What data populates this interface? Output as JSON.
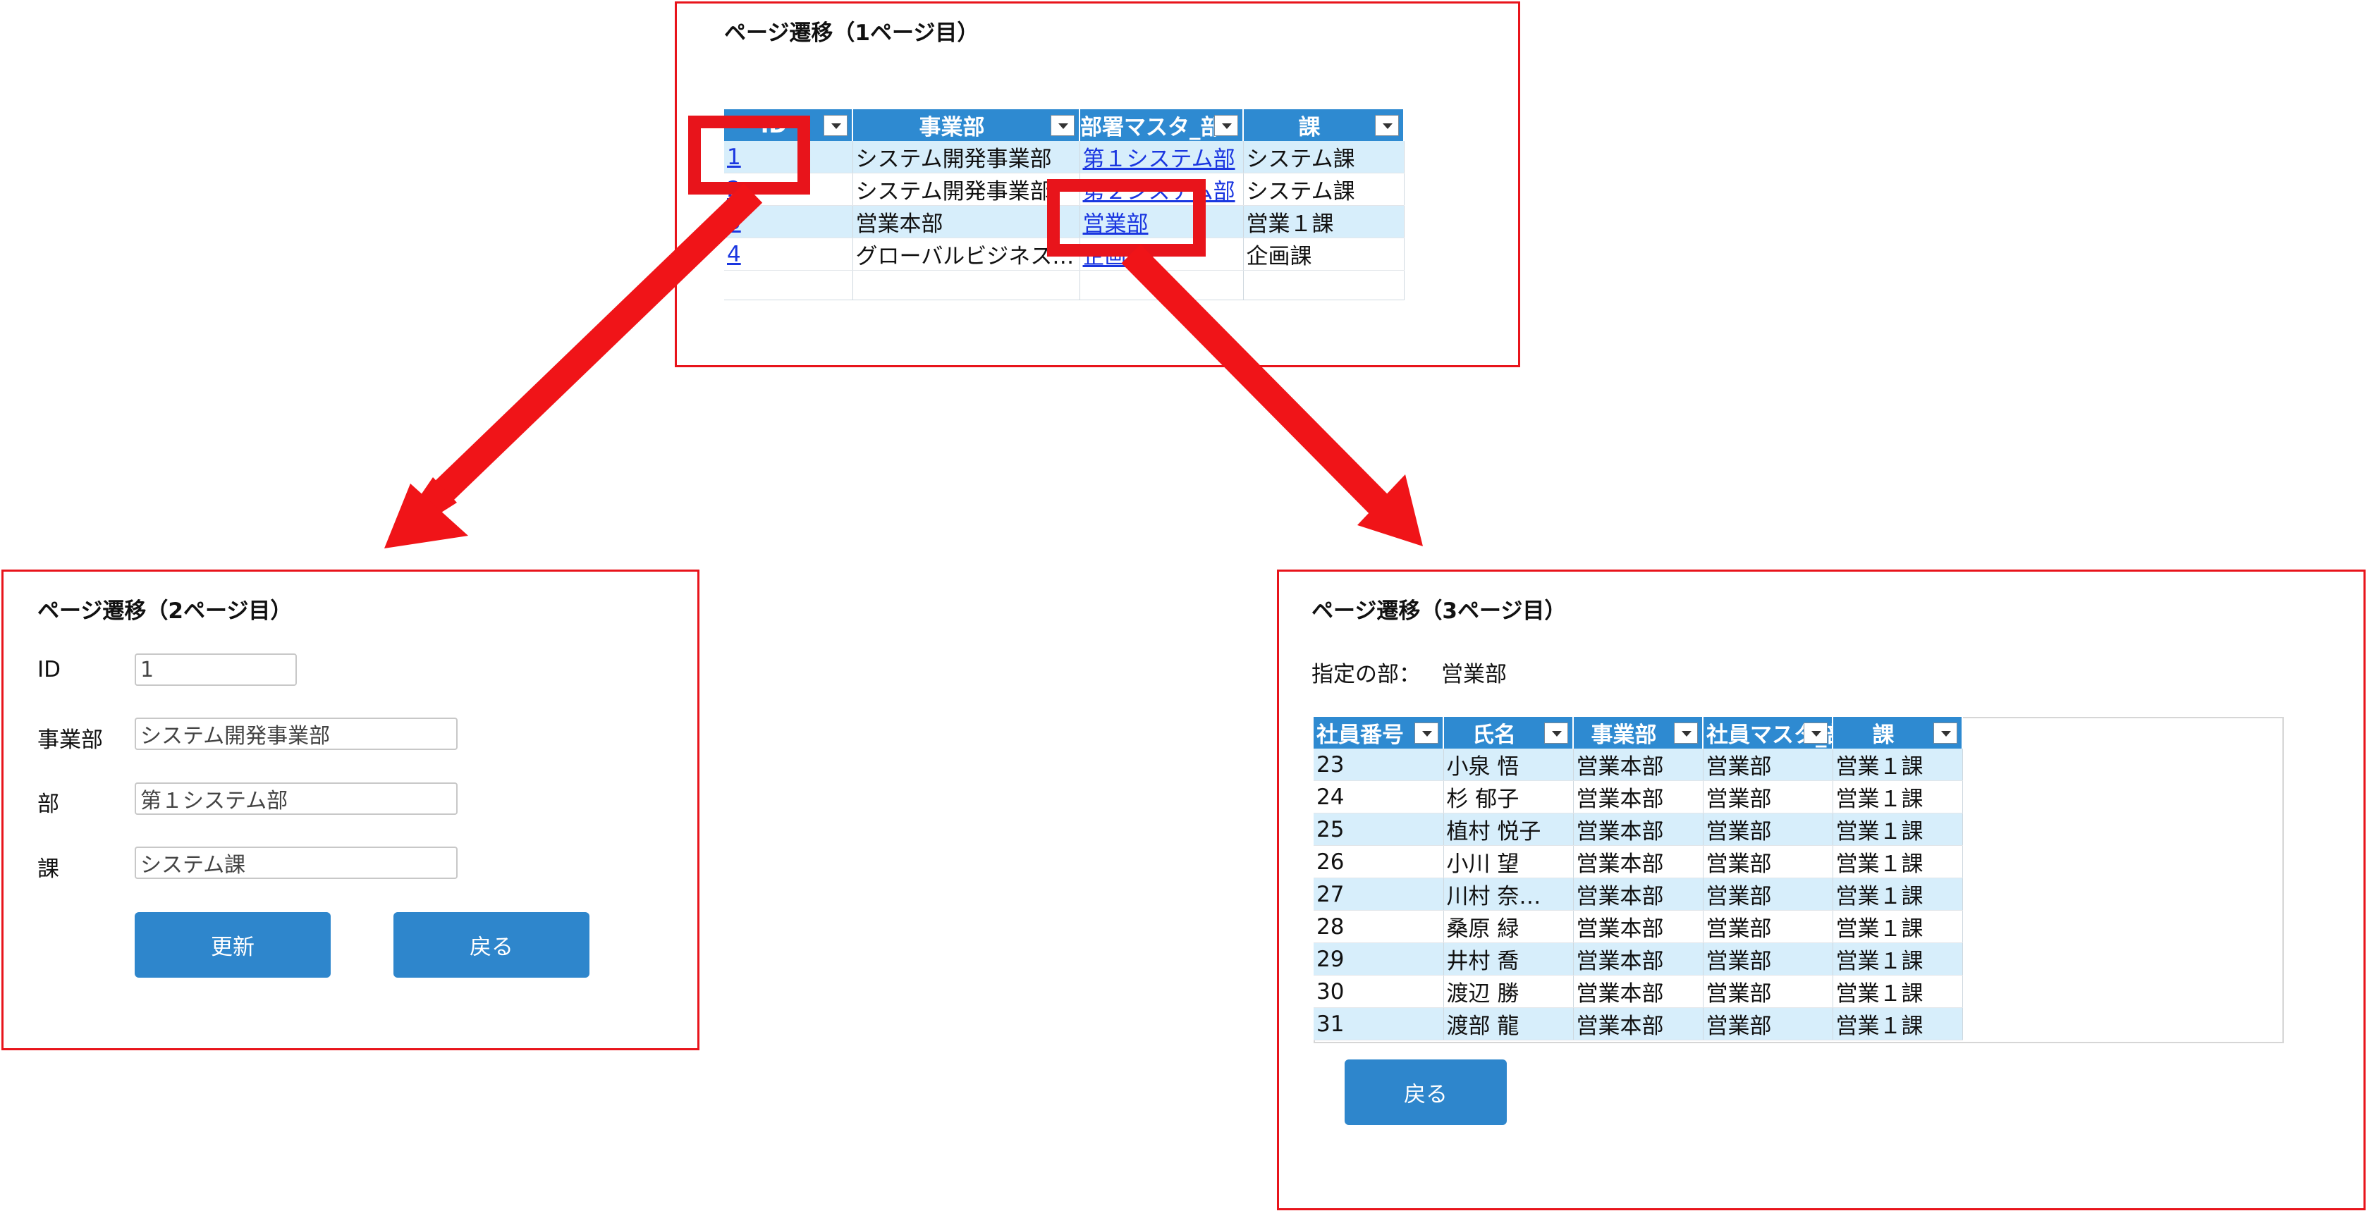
{
  "page1": {
    "title": "ページ遷移（1ページ目）",
    "columns": [
      "ID",
      "事業部",
      "部署マスタ_部",
      "課"
    ],
    "rows": [
      {
        "id": "1",
        "division": "システム開発事業部",
        "department": "第１システム部",
        "section": "システム課"
      },
      {
        "id": "2",
        "division": "システム開発事業部",
        "department": "第２システム部",
        "section": "システム課"
      },
      {
        "id": "3",
        "division": "営業本部",
        "department": "営業部",
        "section": "営業１課"
      },
      {
        "id": "4",
        "division": "グローバルビジネス事…",
        "department": "企画部",
        "section": "企画課"
      }
    ]
  },
  "page2": {
    "title": "ページ遷移（2ページ目）",
    "fields": {
      "id_label": "ID",
      "id_value": "1",
      "division_label": "事業部",
      "division_value": "システム開発事業部",
      "department_label": "部",
      "department_value": "第１システム部",
      "section_label": "課",
      "section_value": "システム課"
    },
    "update_button": "更新",
    "back_button": "戻る"
  },
  "page3": {
    "title": "ページ遷移（3ページ目）",
    "selected_label": "指定の部：",
    "selected_value": "営業部",
    "columns": [
      "社員番号",
      "氏名",
      "事業部",
      "社員マスタ_部",
      "課"
    ],
    "rows": [
      {
        "no": "23",
        "name": "小泉 悟",
        "division": "営業本部",
        "department": "営業部",
        "section": "営業１課"
      },
      {
        "no": "24",
        "name": "杉 郁子",
        "division": "営業本部",
        "department": "営業部",
        "section": "営業１課"
      },
      {
        "no": "25",
        "name": "植村 悦子",
        "division": "営業本部",
        "department": "営業部",
        "section": "営業１課"
      },
      {
        "no": "26",
        "name": "小川 望",
        "division": "営業本部",
        "department": "営業部",
        "section": "営業１課"
      },
      {
        "no": "27",
        "name": "川村 奈…",
        "division": "営業本部",
        "department": "営業部",
        "section": "営業１課"
      },
      {
        "no": "28",
        "name": "桑原 緑",
        "division": "営業本部",
        "department": "営業部",
        "section": "営業１課"
      },
      {
        "no": "29",
        "name": "井村 喬",
        "division": "営業本部",
        "department": "営業部",
        "section": "営業１課"
      },
      {
        "no": "30",
        "name": "渡辺 勝",
        "division": "営業本部",
        "department": "営業部",
        "section": "営業１課"
      },
      {
        "no": "31",
        "name": "渡部 龍",
        "division": "営業本部",
        "department": "営業部",
        "section": "営業１課"
      }
    ],
    "back_button": "戻る"
  },
  "colors": {
    "accent": "#2e86cc",
    "highlight": "#e8141b",
    "row_alt": "#d7eefb",
    "link": "#1a36e0"
  }
}
